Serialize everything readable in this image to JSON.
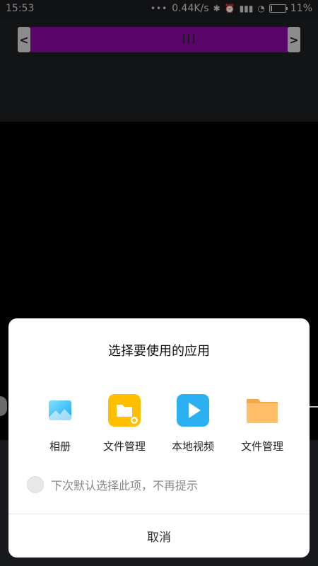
{
  "status_bar": {
    "time": "15:53",
    "network_speed": "0.44K/s",
    "battery_percent": "11%",
    "battery_level": 0.11,
    "icons": [
      "dots-icon",
      "bluetooth-icon",
      "alarm-icon",
      "signal-icon",
      "wifi-icon",
      "battery-icon"
    ]
  },
  "trimmer": {
    "left_arrow": "<",
    "right_arrow": ">",
    "accent_color": "#8b08a1"
  },
  "dialog": {
    "title": "选择要使用的应用",
    "apps": [
      {
        "label": "相册",
        "icon": "gallery-icon"
      },
      {
        "label": "文件管理",
        "icon": "file-manager-yellow-icon"
      },
      {
        "label": "本地视频",
        "icon": "local-video-icon"
      },
      {
        "label": "文件管理",
        "icon": "folder-orange-icon"
      }
    ],
    "remember_choice_label": "下次默认选择此项，不再提示",
    "cancel_label": "取消"
  }
}
